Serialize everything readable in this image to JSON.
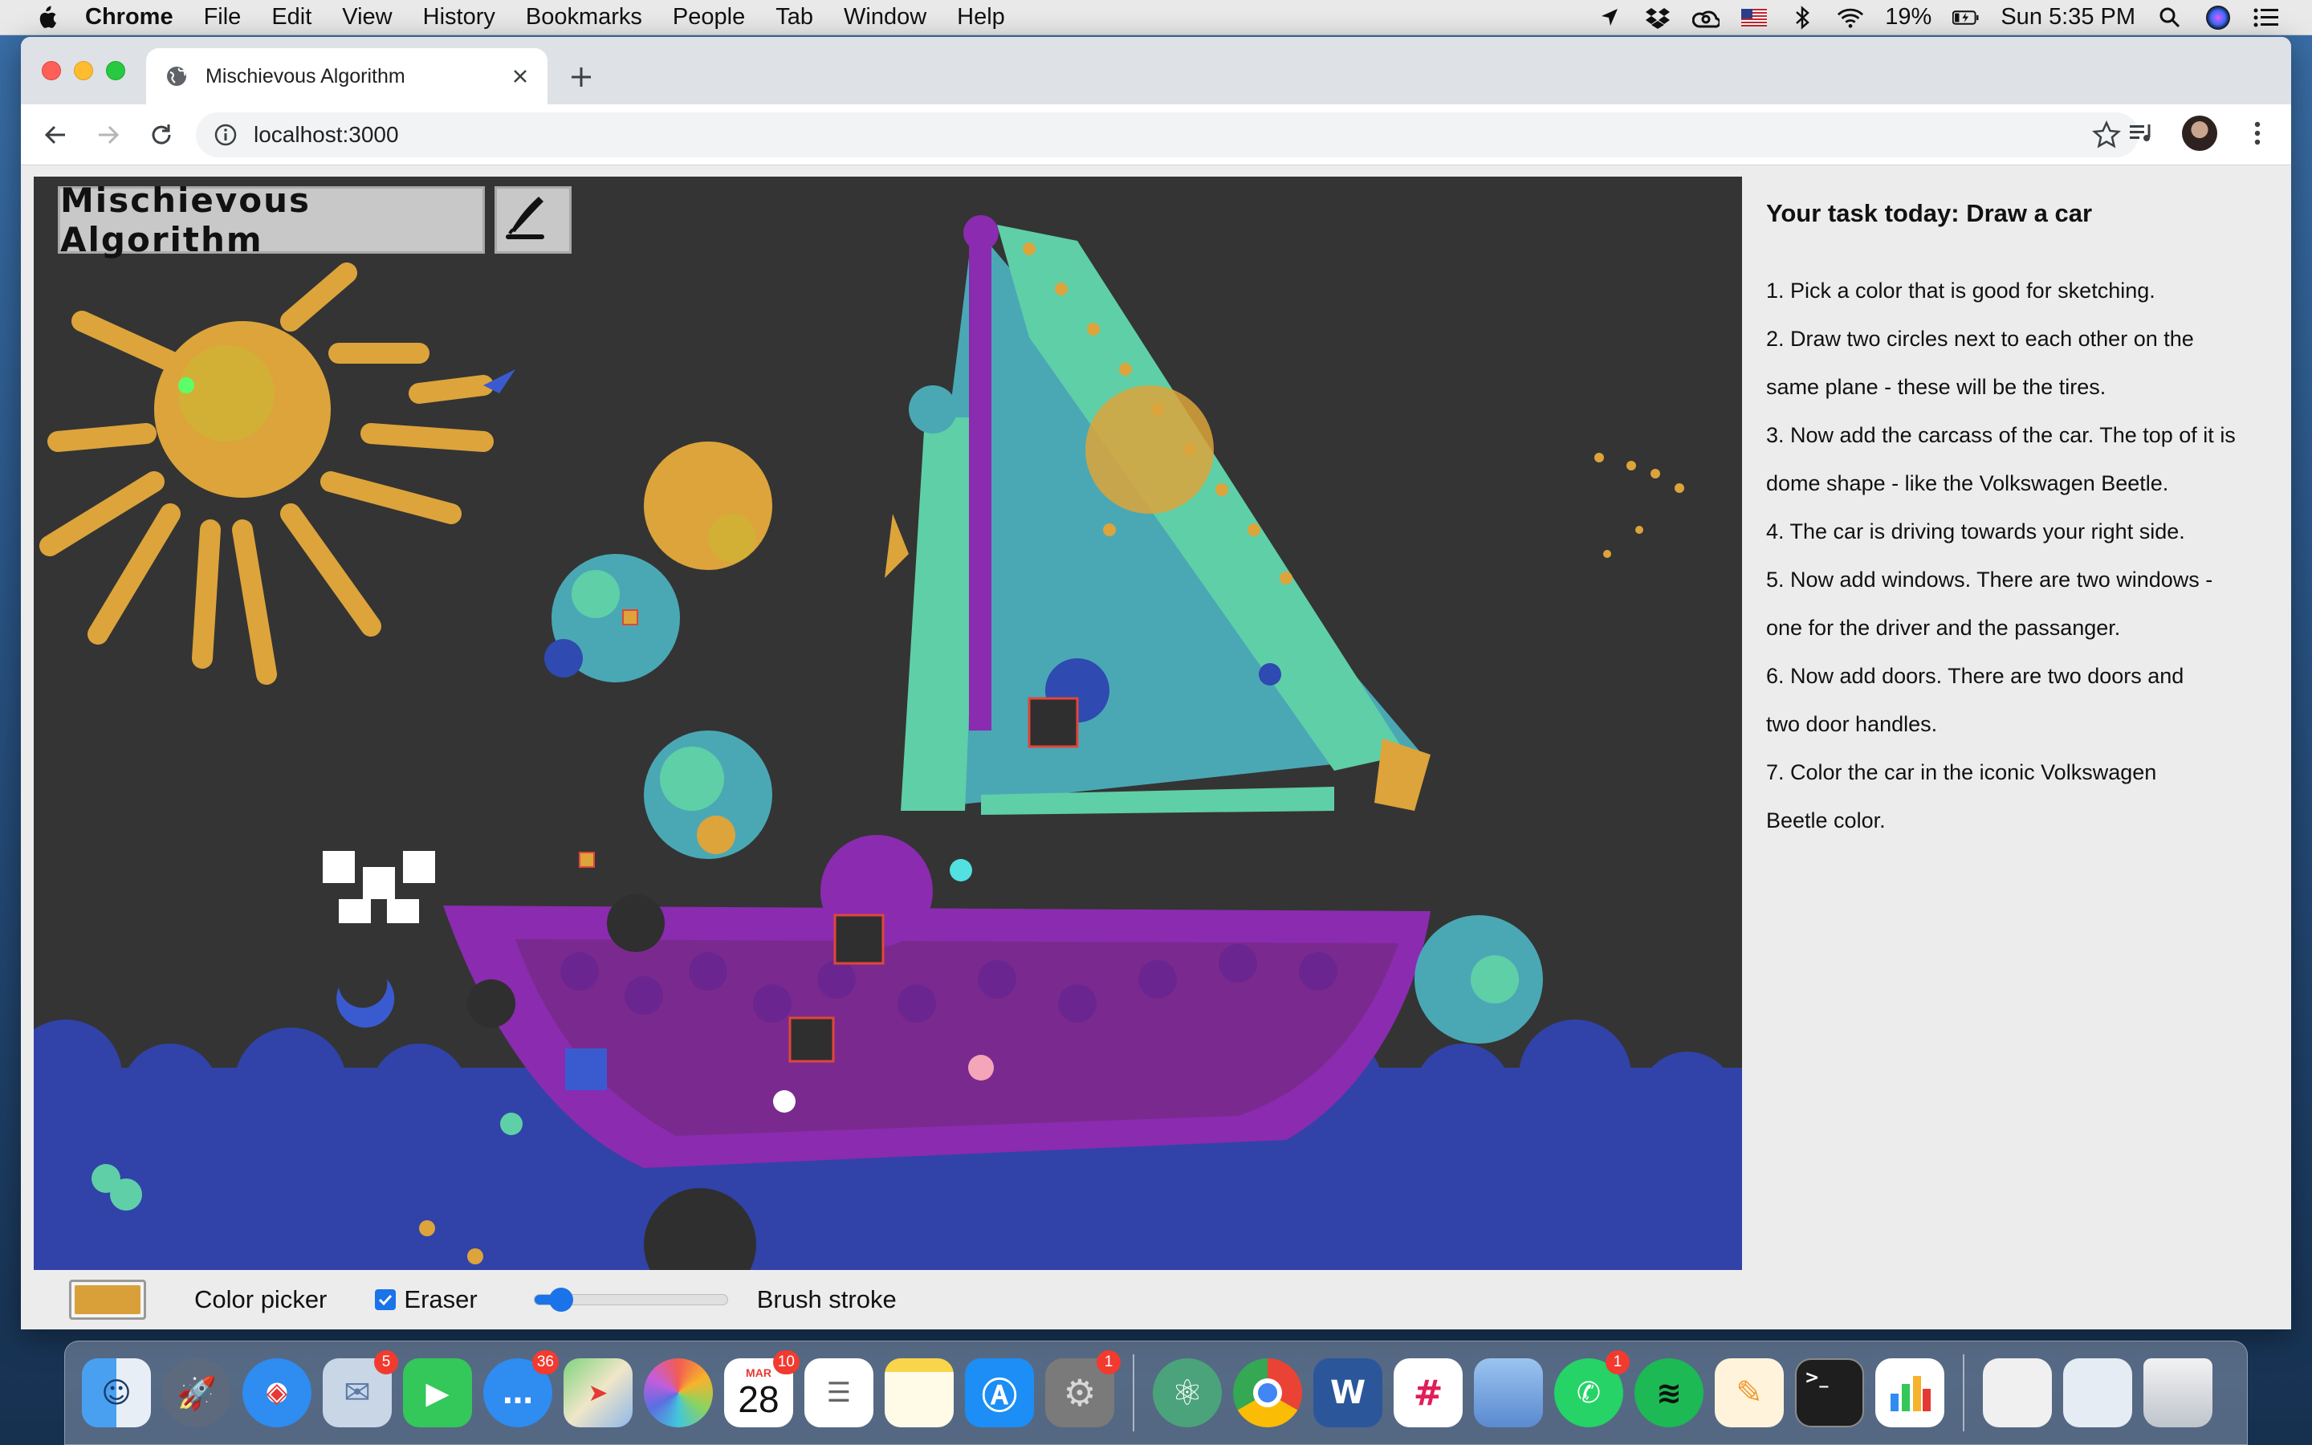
{
  "menubar": {
    "app": "Chrome",
    "items": [
      "File",
      "Edit",
      "View",
      "History",
      "Bookmarks",
      "People",
      "Tab",
      "Window",
      "Help"
    ],
    "battery": "19%",
    "clock": "Sun 5:35 PM"
  },
  "browser": {
    "tab_title": "Mischievous Algorithm",
    "url": "localhost:3000"
  },
  "app": {
    "logo": "Mischievous Algorithm",
    "task_title": "Your task today: Draw a car",
    "steps": [
      "1. Pick a color that is good for sketching.",
      "2. Draw two circles next to each other on the",
      " same plane - these will be the tires.",
      "3. Now add the carcass of the car. The top of it is",
      " dome shape - like the Volkswagen Beetle.",
      "4. The car is driving towards your right side.",
      "5. Now add windows. There are two windows -",
      "one for the driver and the passanger.",
      "6. Now add doors. There are two doors and",
      "two door handles.",
      "7. Color the car in the iconic Volkswagen",
      " Beetle color."
    ],
    "controls": {
      "color_picker_label": "Color picker",
      "selected_color": "#d9a03a",
      "eraser_label": "Eraser",
      "eraser_checked": true,
      "brush_label": "Brush stroke",
      "brush_value": 0.1
    }
  },
  "dock": {
    "badges": {
      "mail": "5",
      "messages": "36",
      "calendar": "10",
      "system_prefs": "1",
      "whatsapp": "1"
    },
    "calendar_month": "MAR",
    "calendar_day": "28"
  },
  "colors": {
    "canvas_bg": "#343434",
    "sun": "#dca43b",
    "sail": "#5fcfa8",
    "sail_dark": "#4aa8b5",
    "boat": "#8a2bb0",
    "water": "#3143a8",
    "accent": "#1a73e8"
  }
}
